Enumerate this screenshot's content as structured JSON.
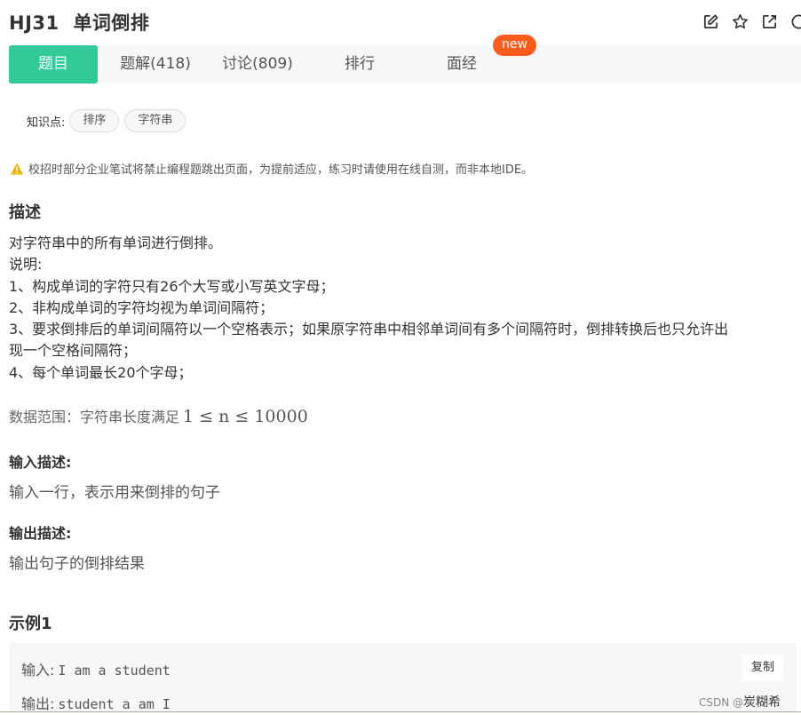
{
  "header": {
    "code": "HJ31",
    "title": "单词倒排",
    "icons": [
      "edit-icon",
      "star-icon",
      "external-link-icon",
      "more-icon"
    ]
  },
  "tabs": [
    {
      "label": "题目",
      "active": true
    },
    {
      "label": "题解(418)",
      "active": false
    },
    {
      "label": "讨论(809)",
      "active": false
    },
    {
      "label": "排行",
      "active": false
    },
    {
      "label": "面经",
      "active": false
    }
  ],
  "badge_new": "new",
  "knowledge": {
    "label": "知识点:",
    "tags": [
      "排序",
      "字符串"
    ]
  },
  "warning": "校招时部分企业笔试将禁止编程题跳出页面，为提前适应，练习时请使用在线自测，而非本地IDE。",
  "description": {
    "heading": "描述",
    "lines": [
      "对字符串中的所有单词进行倒排。",
      "说明:",
      "1、构成单词的字符只有26个大写或小写英文字母；",
      "2、非构成单词的字符均视为单词间隔符；",
      "3、要求倒排后的单词间隔符以一个空格表示；如果原字符串中相邻单词间有多个间隔符时，倒排转换后也只允许出",
      "现一个空格间隔符；",
      "4、每个单词最长20个字母；"
    ],
    "range_label": "数据范围：字符串长度满足",
    "range_formula": "1 ≤ n ≤ 10000"
  },
  "input": {
    "heading": "输入描述:",
    "text": "输入一行，表示用来倒排的句子"
  },
  "output": {
    "heading": "输出描述:",
    "text": "输出句子的倒排结果"
  },
  "example": {
    "heading": "示例1",
    "input_label": "输入:",
    "input_value": "I am a student",
    "output_label": "输出:",
    "output_value": "student a am I",
    "copy_label": "复制"
  },
  "watermark": {
    "text": "CSDN @",
    "tail": "炭糊希"
  },
  "colors": {
    "accent": "#32ca99",
    "badge": "#fd5c1d",
    "warning": "#f0b400"
  }
}
